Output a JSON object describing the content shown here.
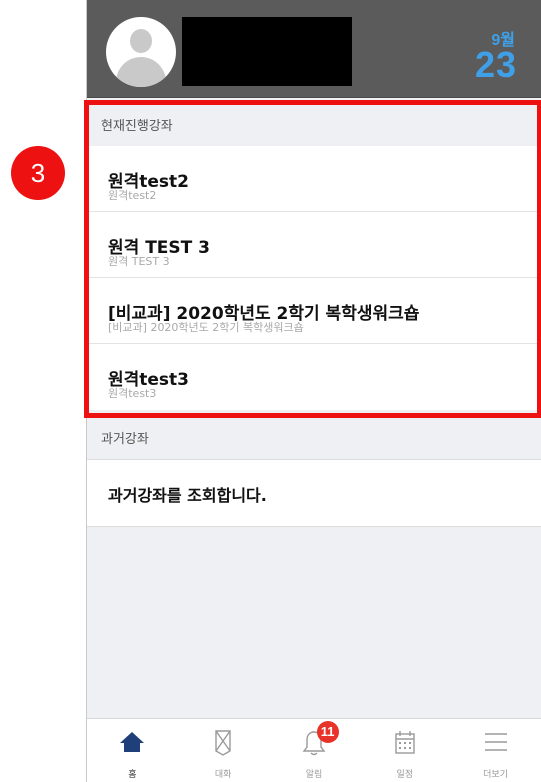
{
  "header": {
    "month": "9월",
    "day": "23"
  },
  "step_marker": "3",
  "current_courses": {
    "heading": "현재진행강좌",
    "items": [
      {
        "title": "원격test2",
        "subtitle": "원격test2"
      },
      {
        "title": "원격 TEST 3",
        "subtitle": "원격 TEST 3"
      },
      {
        "title": "[비교과] 2020학년도 2학기 복학생워크숍",
        "subtitle": "[비교과] 2020학년도 2학기 복학생워크숍"
      },
      {
        "title": "원격test3",
        "subtitle": "원격test3"
      }
    ]
  },
  "past_courses": {
    "heading": "과거강좌",
    "row_label": "과거강좌를 조회합니다."
  },
  "tabbar": {
    "tabs": [
      {
        "label": "홈",
        "icon": "home-icon",
        "active": true
      },
      {
        "label": "대화",
        "icon": "chat-icon",
        "active": false
      },
      {
        "label": "알림",
        "icon": "bell-icon",
        "active": false
      },
      {
        "label": "일정",
        "icon": "calendar-icon",
        "active": false
      },
      {
        "label": "더보기",
        "icon": "menu-icon",
        "active": false
      }
    ],
    "notification_count": "11"
  },
  "colors": {
    "header_bg": "#5b5b5b",
    "date_accent": "#3fa0e8",
    "highlight": "#ee1111",
    "active_tab": "#1f3f7a",
    "badge": "#e8332a"
  }
}
